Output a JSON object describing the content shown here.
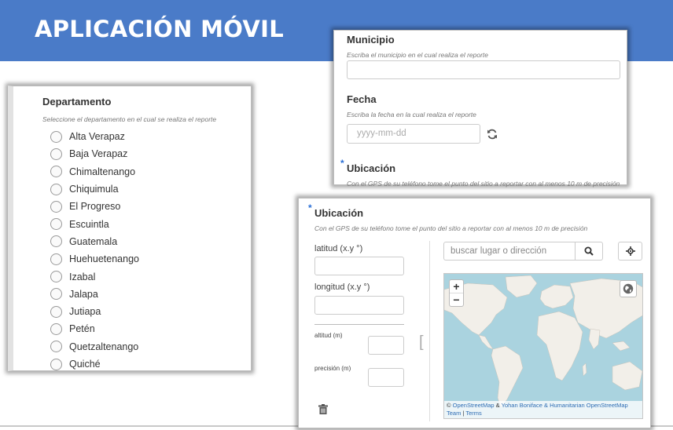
{
  "banner": {
    "title": "APLICACIÓN MÓVIL"
  },
  "departamento": {
    "label": "Departamento",
    "hint": "Seleccione el departamento en el cual se realiza el reporte",
    "options": [
      "Alta Verapaz",
      "Baja Verapaz",
      "Chimaltenango",
      "Chiquimula",
      "El Progreso",
      "Escuintla",
      "Guatemala",
      "Huehuetenango",
      "Izabal",
      "Jalapa",
      "Jutiapa",
      "Petén",
      "Quetzaltenango",
      "Quiché"
    ]
  },
  "municipio": {
    "label": "Municipio",
    "hint": "Escriba el municipio en el cual realiza el reporte",
    "value": ""
  },
  "fecha": {
    "label": "Fecha",
    "hint": "Escriba la fecha en la cual realiza el reporte",
    "placeholder": "yyyy-mm-dd"
  },
  "ubicacion": {
    "required_mark": "*",
    "label": "Ubicación",
    "hint": "Con el GPS de su teléfono tome el punto del sitio a reportar con al menos 10 m de precisión",
    "latitud_label": "latitud (x.y °)",
    "longitud_label": "longitud (x.y °)",
    "altitud_label": "altitud (m)",
    "precision_label": "precisión (m)",
    "bracket": "[",
    "search_placeholder": "buscar lugar o dirección",
    "zoom_in": "+",
    "zoom_out": "−",
    "attribution": {
      "prefix": "© ",
      "osm1": "OpenStreetMap",
      "amp": " & ",
      "yohan": "Yohan Boniface & Humanitarian",
      "osm2": " OpenStreetMap",
      "team": "Team",
      "sep": " | ",
      "terms": "Terms"
    }
  },
  "icons": {
    "refresh": "refresh-icon",
    "search": "search-icon",
    "locate": "crosshair-icon",
    "layers": "globe-icon",
    "trash": "trash-icon"
  },
  "colors": {
    "banner": "#4a7bc8",
    "required": "#2a6fd6",
    "map_water": "#aad3df",
    "map_land": "#f2efe9",
    "link": "#2e6db4"
  }
}
